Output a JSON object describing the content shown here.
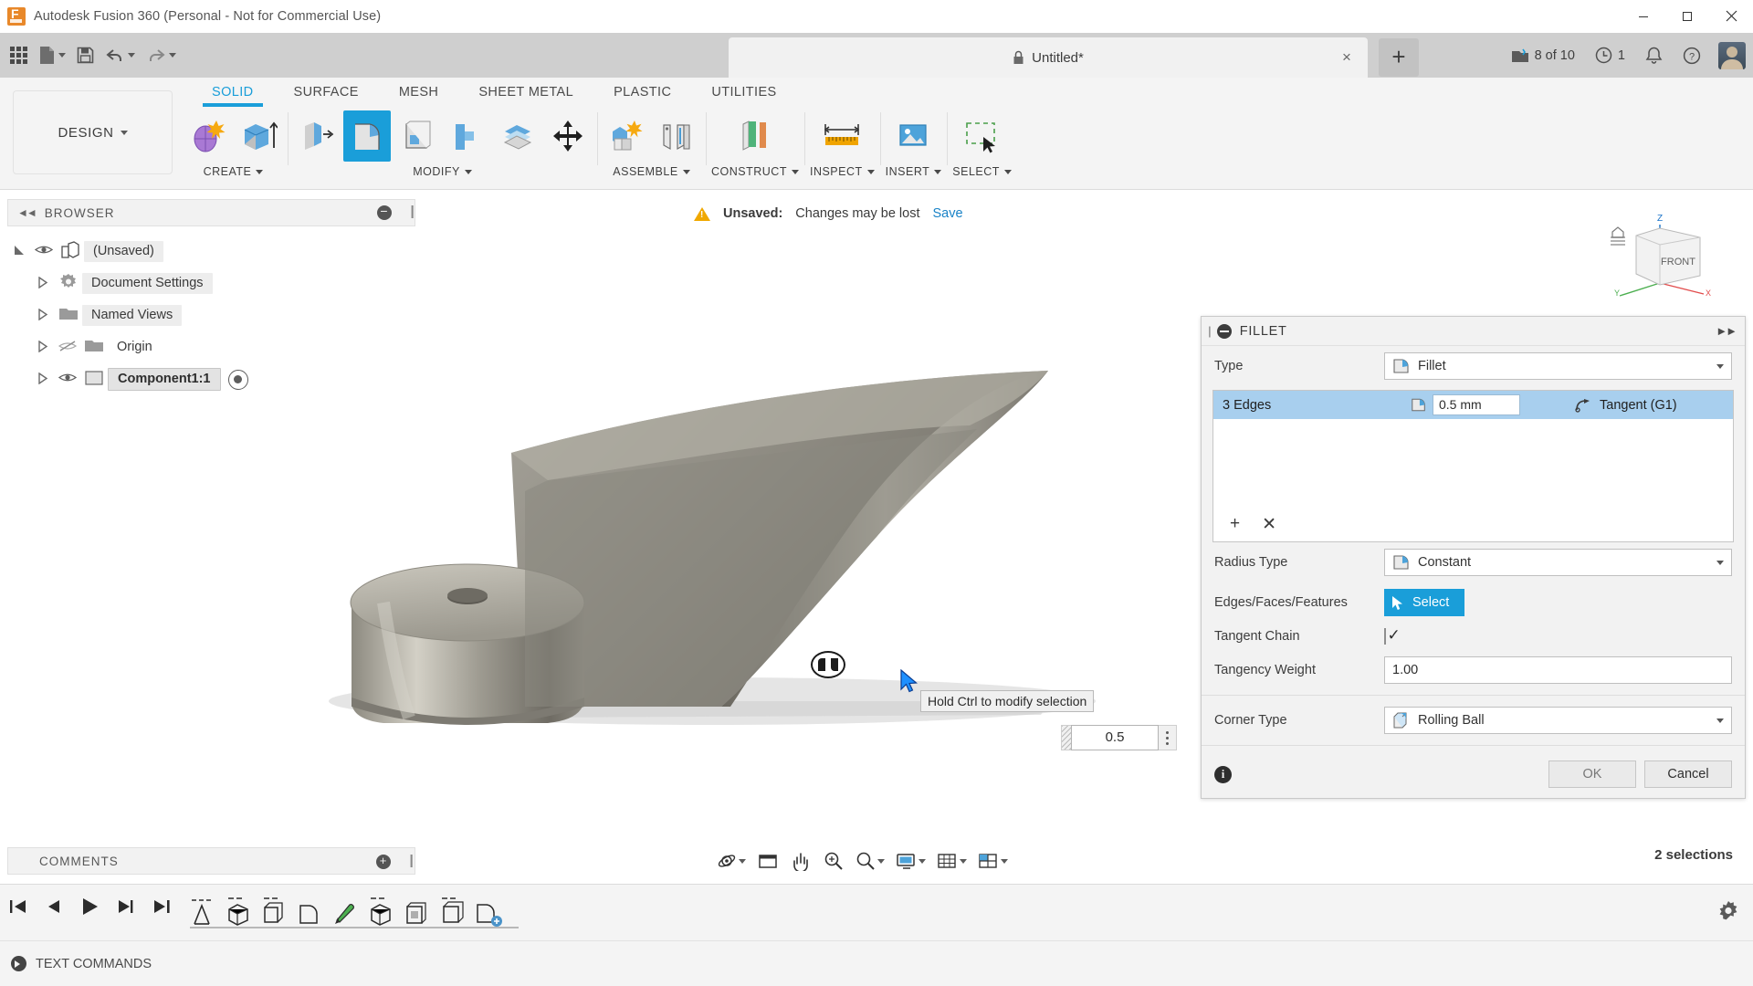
{
  "window": {
    "app_title": "Autodesk Fusion 360 (Personal - Not for Commercial Use)",
    "app_icon": "fusion360-logo-icon",
    "minimize": "minimize-icon",
    "maximize": "maximize-icon",
    "close": "close-icon"
  },
  "quick_access": {
    "apps_grid": "app-grid-icon",
    "new": "new-file-icon",
    "save": "save-icon",
    "undo": "undo-icon",
    "redo": "redo-icon",
    "document_tab": {
      "label": "Untitled*",
      "lock_icon": "lock-icon",
      "close": "×"
    },
    "new_tab": "+",
    "jobs": {
      "label": "8 of 10",
      "icon": "jobs-icon"
    },
    "history": {
      "label": "1",
      "icon": "clock-icon"
    },
    "notifications": "bell-icon",
    "help": "help-icon",
    "account": "avatar"
  },
  "ribbon": {
    "design_label": "DESIGN",
    "workspace_tabs": [
      {
        "label": "SOLID",
        "active": true
      },
      {
        "label": "SURFACE",
        "active": false
      },
      {
        "label": "MESH",
        "active": false
      },
      {
        "label": "SHEET METAL",
        "active": false
      },
      {
        "label": "PLASTIC",
        "active": false
      },
      {
        "label": "UTILITIES",
        "active": false
      }
    ],
    "groups": [
      {
        "label": "CREATE",
        "dropdown": true,
        "tools": [
          "create-sketch-icon",
          "extrude-icon"
        ]
      },
      {
        "label": "MODIFY",
        "dropdown": true,
        "tools": [
          "press-pull-icon",
          "fillet-icon",
          "shell-icon",
          "draft-icon",
          "scale-icon",
          "move-copy-icon"
        ]
      },
      {
        "label": "ASSEMBLE",
        "dropdown": true,
        "tools": [
          "new-component-icon",
          "joint-icon"
        ]
      },
      {
        "label": "CONSTRUCT",
        "dropdown": true,
        "tools": [
          "offset-plane-icon"
        ]
      },
      {
        "label": "INSPECT",
        "dropdown": true,
        "tools": [
          "measure-icon"
        ]
      },
      {
        "label": "INSERT",
        "dropdown": true,
        "tools": [
          "insert-image-icon"
        ]
      },
      {
        "label": "SELECT",
        "dropdown": true,
        "tools": [
          "select-window-icon"
        ]
      }
    ]
  },
  "browser": {
    "title": "BROWSER",
    "collapse_icon": "collapse-left-icon",
    "panel_dot": "−",
    "tree": [
      {
        "label": "(Unsaved)",
        "icon": "component-icon",
        "eye": true,
        "expanded": true,
        "indent": 0
      },
      {
        "label": "Document Settings",
        "icon": "gear-icon",
        "eye": false,
        "expanded": false,
        "indent": 1
      },
      {
        "label": "Named Views",
        "icon": "folder-icon",
        "eye": false,
        "expanded": false,
        "indent": 1
      },
      {
        "label": "Origin",
        "icon": "folder-icon",
        "eye": true,
        "hidden": true,
        "expanded": false,
        "indent": 1
      },
      {
        "label": "Component1:1",
        "icon": "component-body-icon",
        "eye": true,
        "expanded": false,
        "indent": 1,
        "selected": true
      }
    ]
  },
  "canvas": {
    "unsaved_warning": {
      "icon": "warning-icon",
      "label": "Unsaved:",
      "message": "Changes may be lost",
      "save_link": "Save"
    },
    "viewcube": {
      "face": "FRONT",
      "axis_z": "Z",
      "axis_y": "Y",
      "axis_x": "X",
      "home_icon": "home-icon"
    },
    "tooltip": "Hold Ctrl to modify selection",
    "selection_glyph": "fillet-handle-icon",
    "cursor": "arrow-cursor-icon",
    "radius_float_value": "0.5"
  },
  "fillet_dialog": {
    "title": "FILLET",
    "minimize_icon": "collapse-dialog-icon",
    "expand_icon": "expand-right-icon",
    "type_label": "Type",
    "type_value": "Fillet",
    "type_icon": "fillet-icon",
    "edge_selection": {
      "name": "3 Edges",
      "radius_icon": "fillet-icon",
      "radius_value": "0.5 mm",
      "continuity_icon": "tangent-icon",
      "continuity": "Tangent (G1)"
    },
    "add_button": "+",
    "remove_button": "✕",
    "radius_type_label": "Radius Type",
    "radius_type_value": "Constant",
    "radius_type_icon": "constant-radius-icon",
    "edges_label": "Edges/Faces/Features",
    "select_button": "Select",
    "select_icon": "cursor-select-icon",
    "tangent_chain_label": "Tangent Chain",
    "tangent_chain_checked": true,
    "tangency_weight_label": "Tangency Weight",
    "tangency_weight_value": "1.00",
    "corner_type_label": "Corner Type",
    "corner_type_value": "Rolling Ball",
    "corner_type_icon": "rolling-ball-icon",
    "info_icon": "info-icon",
    "ok_button": "OK",
    "cancel_button": "Cancel"
  },
  "status": {
    "comments_label": "COMMENTS",
    "comments_dot": "+",
    "selections": "2 selections"
  },
  "navigation_bar": {
    "orbit": "orbit-icon",
    "look_at": "look-at-icon",
    "pan": "pan-icon",
    "zoom": "zoom-icon",
    "fit": "fit-icon",
    "display_settings": "display-settings-icon",
    "grid_snap": "grid-snaps-icon",
    "viewports": "viewports-icon"
  },
  "timeline": {
    "go_start": "skip-start-icon",
    "step_back": "step-back-icon",
    "play": "play-icon",
    "step_forward": "step-forward-icon",
    "go_end": "skip-end-icon",
    "features": [
      "sketch-icon",
      "extrude-icon",
      "extrude-icon",
      "fillet-icon",
      "paint-icon",
      "extrude-icon",
      "shell-icon",
      "extrude-icon",
      "fillet-icon"
    ],
    "settings_icon": "gear-icon"
  },
  "text_commands": {
    "label": "TEXT COMMANDS",
    "icon": "text-commands-icon"
  },
  "colors": {
    "accent_blue": "#1a9ed9",
    "selection_blue": "#a8cfee",
    "warning_amber": "#f0a800",
    "titlebar": "#ffffff",
    "qat_bar": "#cfcfcf",
    "ribbon": "#f4f4f4"
  }
}
